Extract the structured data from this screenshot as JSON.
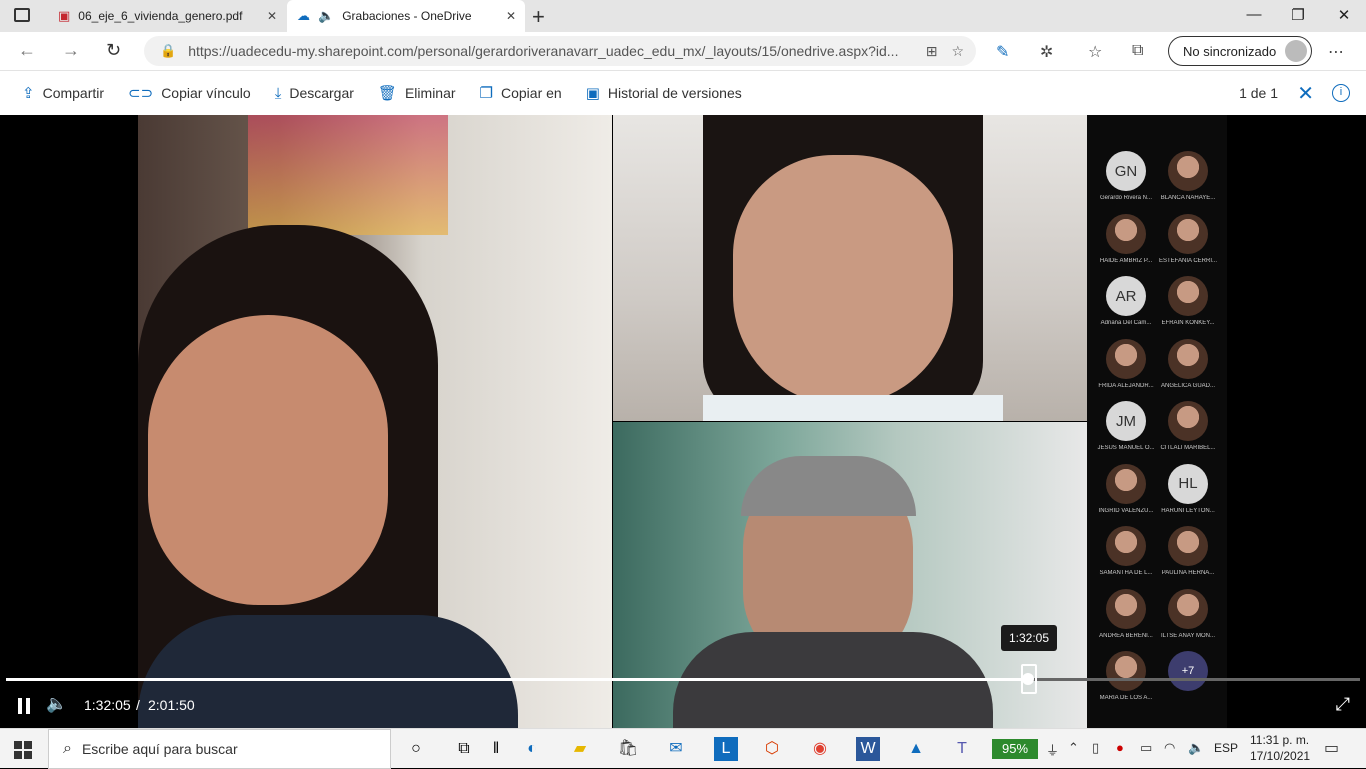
{
  "browser": {
    "tabs": [
      {
        "label": "06_eje_6_vivienda_genero.pdf",
        "icon": "pdf-icon",
        "active": false
      },
      {
        "label": "Grabaciones - OneDrive",
        "icon": "onedrive-icon",
        "active": true
      }
    ],
    "url": "https://uadecedu-my.sharepoint.com/personal/gerardoriveranavarr_uadec_edu_mx/_layouts/15/onedrive.aspx?id...",
    "profile_label": "No sincronizado"
  },
  "commandbar": {
    "share": "Compartir",
    "copy_link": "Copiar vínculo",
    "download": "Descargar",
    "delete": "Eliminar",
    "copy_to": "Copiar en",
    "version_history": "Historial de versiones",
    "page_info": "1 de 1",
    "accent": "#0f6cbd"
  },
  "player": {
    "current_time": "1:32:05",
    "total_time": "2:01:50",
    "tooltip_time": "1:32:05",
    "progress": 0.755
  },
  "participants": [
    {
      "initials": "GN",
      "name": "Gerardo Rivera N..."
    },
    {
      "initials": "",
      "name": "BLANCA NAHAYE..."
    },
    {
      "initials": "",
      "name": "HAIDE AMBRIZ P..."
    },
    {
      "initials": "",
      "name": "ESTEFANIA CERRI..."
    },
    {
      "initials": "AR",
      "name": "Adriana Del Cam..."
    },
    {
      "initials": "",
      "name": "EFRAIN KONKEY..."
    },
    {
      "initials": "",
      "name": "FRIDA ALEJANDR..."
    },
    {
      "initials": "",
      "name": "ANGELICA GUAD..."
    },
    {
      "initials": "JM",
      "name": "JESUS MANUEL O..."
    },
    {
      "initials": "",
      "name": "CITLALI MARIBEL..."
    },
    {
      "initials": "",
      "name": "INGRID VALENZU..."
    },
    {
      "initials": "HL",
      "name": "HARUNI LEYTON..."
    },
    {
      "initials": "",
      "name": "SAMANTHA DE L..."
    },
    {
      "initials": "",
      "name": "PAULINA HERNA..."
    },
    {
      "initials": "",
      "name": "ANDREA BERENI..."
    },
    {
      "initials": "",
      "name": "ILTSE ANAY MON..."
    },
    {
      "initials": "",
      "name": "MARIA DE LOS A..."
    },
    {
      "initials": "+7",
      "name": ""
    }
  ],
  "taskbar": {
    "search_placeholder": "Escribe aquí para buscar",
    "battery": "95%",
    "language": "ESP",
    "time": "11:31 p. m.",
    "date": "17/10/2021",
    "battery_color": "#2d8a2d"
  }
}
